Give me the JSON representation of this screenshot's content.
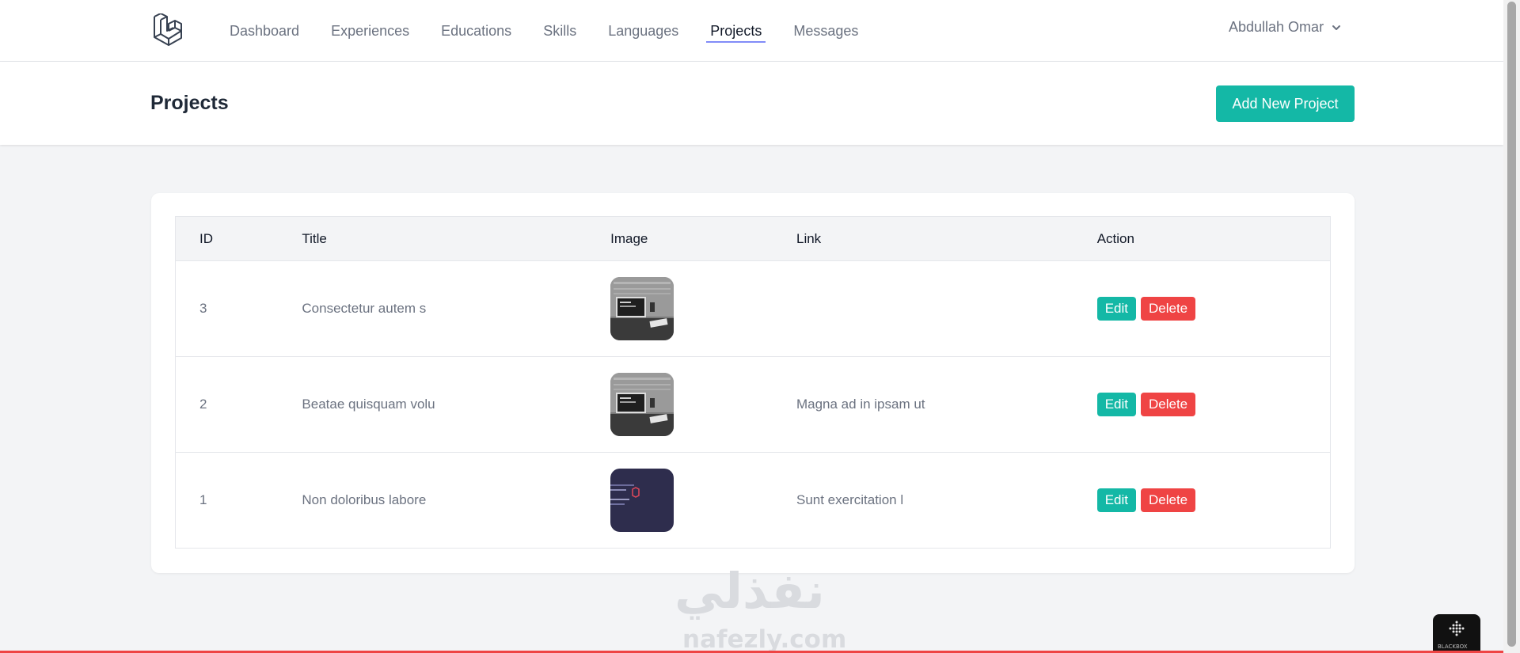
{
  "nav": {
    "items": [
      {
        "label": "Dashboard",
        "active": false
      },
      {
        "label": "Experiences",
        "active": false
      },
      {
        "label": "Educations",
        "active": false
      },
      {
        "label": "Skills",
        "active": false
      },
      {
        "label": "Languages",
        "active": false
      },
      {
        "label": "Projects",
        "active": true
      },
      {
        "label": "Messages",
        "active": false
      }
    ],
    "user_name": "Abdullah Omar"
  },
  "header": {
    "title": "Projects",
    "add_button_label": "Add New Project"
  },
  "table": {
    "columns": [
      "ID",
      "Title",
      "Image",
      "Link",
      "Action"
    ],
    "rows": [
      {
        "id": "3",
        "title": "Consectetur autem s",
        "image": "workspace-grayscale",
        "link": "",
        "edit": "Edit",
        "delete": "Delete"
      },
      {
        "id": "2",
        "title": "Beatae quisquam volu",
        "image": "workspace-grayscale",
        "link": "Magna ad in ipsam ut",
        "edit": "Edit",
        "delete": "Delete"
      },
      {
        "id": "1",
        "title": "Non doloribus labore",
        "image": "laravel-dark-banner",
        "link": "Sunt exercitation l",
        "edit": "Edit",
        "delete": "Delete"
      }
    ]
  },
  "watermark": {
    "arabic": "نفذلي",
    "latin": "nafezly.com"
  },
  "badge": {
    "label": "BLACKBOX"
  },
  "colors": {
    "accent_teal": "#14b8a6",
    "danger_red": "#ef4444",
    "active_underline": "#818cf8"
  }
}
